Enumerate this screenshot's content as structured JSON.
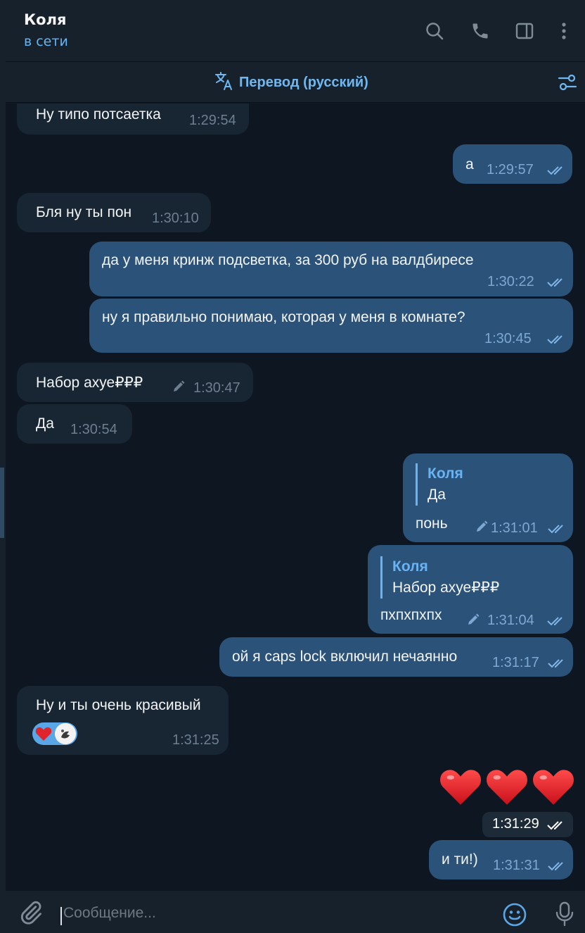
{
  "header": {
    "name": "Коля",
    "status": "в сети",
    "icons": [
      "search-icon",
      "phone-icon",
      "sidebar-panel-icon",
      "more-vertical-icon"
    ]
  },
  "translation_bar": {
    "label": "Перевод (русский)",
    "icon": "translate-icon",
    "settings_icon": "sliders-icon"
  },
  "messages": [
    {
      "dir": "in",
      "text": "Ну типо потсаетка",
      "time": "1:29:54"
    },
    {
      "dir": "out",
      "text": "а",
      "time": "1:29:57",
      "read": true
    },
    {
      "dir": "in",
      "text": "Бля ну ты пон",
      "time": "1:30:10"
    },
    {
      "dir": "out",
      "text": "да у меня кринж подсветка, за 300 руб на валдбиресе",
      "time": "1:30:22",
      "read": true
    },
    {
      "dir": "out",
      "text": "ну я правильно понимаю, которая у меня в комнате?",
      "time": "1:30:45",
      "read": true
    },
    {
      "dir": "in",
      "text": "Набор  ахуе₽₽₽",
      "time": "1:30:47",
      "edited": true
    },
    {
      "dir": "in",
      "text": "Да",
      "time": "1:30:54"
    },
    {
      "dir": "out",
      "reply_name": "Коля",
      "reply_text": "Да",
      "text": "понь",
      "time": "1:31:01",
      "edited": true,
      "read": true
    },
    {
      "dir": "out",
      "reply_name": "Коля",
      "reply_text": "Набор  ахуе₽₽₽",
      "text": "пхпхпхпх",
      "time": "1:31:04",
      "edited": true,
      "read": true
    },
    {
      "dir": "out",
      "text": "ой я caps lock включил нечаянно",
      "time": "1:31:17",
      "read": true
    },
    {
      "dir": "in",
      "text": "Ну и ты очень красивый",
      "time": "1:31:25",
      "reactions": [
        "heart-emoji",
        "avatar"
      ]
    },
    {
      "dir": "out",
      "emoji": "❤️❤️❤️",
      "time": "1:31:29",
      "read": true
    },
    {
      "dir": "out",
      "text": "и ти!)",
      "time": "1:31:31",
      "read": true
    }
  ],
  "composer": {
    "placeholder": "Сообщение...",
    "icons": [
      "paperclip-icon",
      "emoji-icon",
      "microphone-icon"
    ]
  },
  "colors": {
    "background": "#0e1621",
    "panel": "#17212b",
    "incoming_bubble": "#182533",
    "outgoing_bubble": "#2b5278",
    "accent": "#6ab3f3"
  }
}
